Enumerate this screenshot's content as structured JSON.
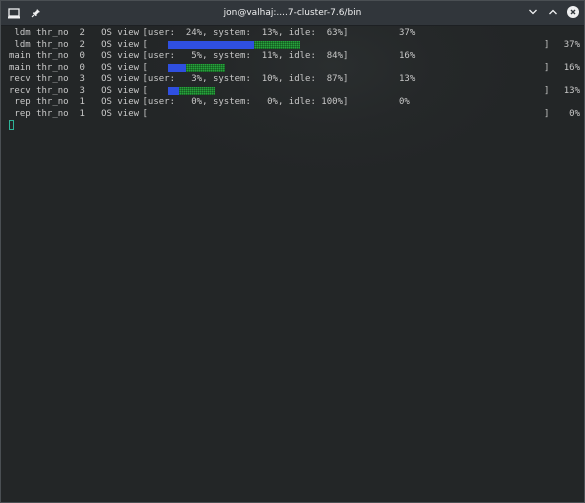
{
  "window": {
    "title": "jon@valhaj:....7-cluster-7.6/bin"
  },
  "titlebar_icons": {
    "app": "terminal-icon",
    "pin": "pin-icon",
    "minimize": "chevron-down-icon",
    "maximize": "chevron-up-icon",
    "close": "close-icon"
  },
  "colors": {
    "bar_user": "#2f4fe0",
    "bar_system": "#27a33c",
    "cursor": "#2eb398",
    "text": "#c8c8c8"
  },
  "terminal": {
    "rows": [
      {
        "kind": "stats",
        "name": " ldm",
        "thr": "thr_no",
        "num": "2",
        "view": "OS view",
        "stats": "[user:  24%, system:  13%, idle:  63%]",
        "total": "37%"
      },
      {
        "kind": "bar",
        "name": " ldm",
        "thr": "thr_no",
        "num": "2",
        "view": "OS view",
        "open": "[",
        "close": "]",
        "total": "37%",
        "user_frac": 0.24,
        "system_frac": 0.13
      },
      {
        "kind": "stats",
        "name": "main",
        "thr": "thr_no",
        "num": "0",
        "view": "OS view",
        "stats": "[user:   5%, system:  11%, idle:  84%]",
        "total": "16%"
      },
      {
        "kind": "bar",
        "name": "main",
        "thr": "thr_no",
        "num": "0",
        "view": "OS view",
        "open": "[",
        "close": "]",
        "total": "16%",
        "user_frac": 0.05,
        "system_frac": 0.11
      },
      {
        "kind": "stats",
        "name": "recv",
        "thr": "thr_no",
        "num": "3",
        "view": "OS view",
        "stats": "[user:   3%, system:  10%, idle:  87%]",
        "total": "13%"
      },
      {
        "kind": "bar",
        "name": "recv",
        "thr": "thr_no",
        "num": "3",
        "view": "OS view",
        "open": "[",
        "close": "]",
        "total": "13%",
        "user_frac": 0.03,
        "system_frac": 0.1
      },
      {
        "kind": "stats",
        "name": " rep",
        "thr": "thr_no",
        "num": "1",
        "view": "OS view",
        "stats": "[user:   0%, system:   0%, idle: 100%]",
        "total": "0%"
      },
      {
        "kind": "bar",
        "name": " rep",
        "thr": "thr_no",
        "num": "1",
        "view": "OS view",
        "open": "[",
        "close": "]",
        "total": "0%",
        "user_frac": 0.0,
        "system_frac": 0.0
      }
    ]
  }
}
